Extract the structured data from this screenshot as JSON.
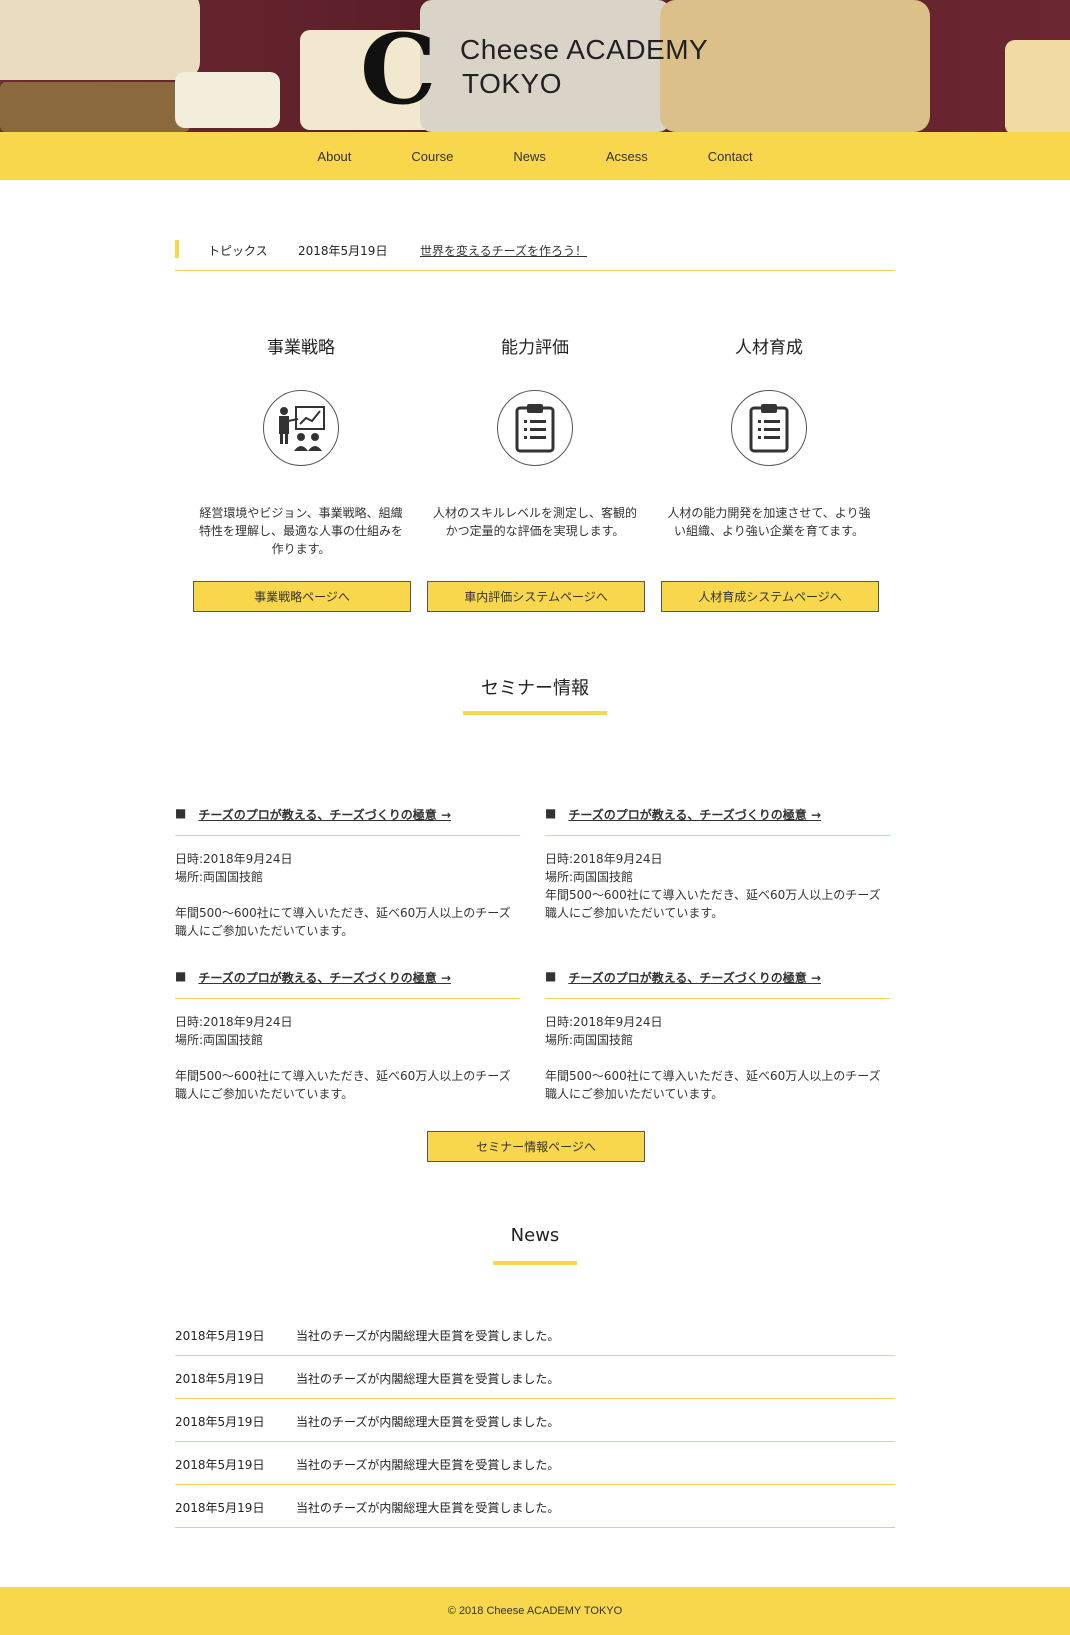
{
  "header": {
    "logo_letter": "C",
    "logo_line1": "Cheese ACADEMY",
    "logo_line2": "TOKYO"
  },
  "nav": [
    "About",
    "Course",
    "News",
    "Acsess",
    "Contact"
  ],
  "topics": {
    "label": "トピックス",
    "date": "2018年5月19日",
    "link": "世界を変えるチーズを作ろう！"
  },
  "features": [
    {
      "title": "事業戦略",
      "icon": "presentation-icon",
      "text": "経営環境やビジョン、事業戦略、組織特性を理解し、最適な人事の仕組みを作ります。",
      "button": "事業戦略ページへ"
    },
    {
      "title": "能力評価",
      "icon": "clipboard-icon",
      "text": "人材のスキルレベルを測定し、客観的かつ定量的な評価を実現します。",
      "button": "車内評価システムページへ"
    },
    {
      "title": "人材育成",
      "icon": "clipboard-icon",
      "text": "人材の能力開発を加速させて、より強い組織、より強い企業を育てます。",
      "button": "人材育成システムページへ"
    }
  ],
  "seminar": {
    "title": "セミナー情報",
    "items": [
      {
        "bullet": "■",
        "title": "チーズのプロが教える、チーズづくりの極意 →",
        "date": "日時:2018年9月24日",
        "place": "場所:両国国技館",
        "desc": "年間500〜600社にて導入いただき、延べ60万人以上のチーズ職人にご参加いただいています。"
      },
      {
        "bullet": "■",
        "title": "チーズのプロが教える、チーズづくりの極意 →",
        "date": "日時:2018年9月24日",
        "place": "場所:両国国技館",
        "desc": "年間500〜600社にて導入いただき、延べ60万人以上のチーズ職人にご参加いただいています。"
      },
      {
        "bullet": "■",
        "title": "チーズのプロが教える、チーズづくりの極意 →",
        "date": "日時:2018年9月24日",
        "place": "場所:両国国技館",
        "desc": "年間500〜600社にて導入いただき、延べ60万人以上のチーズ職人にご参加いただいています。"
      },
      {
        "bullet": "■",
        "title": "チーズのプロが教える、チーズづくりの極意 →",
        "date": "日時:2018年9月24日",
        "place": "場所:両国国技館",
        "desc": "年間500〜600社にて導入いただき、延べ60万人以上のチーズ職人にご参加いただいています。"
      }
    ],
    "button": "セミナー情報ページへ"
  },
  "news": {
    "title": "News",
    "items": [
      {
        "date": "2018年5月19日",
        "text": "当社のチーズが内閣総理大臣賞を受賞しました。"
      },
      {
        "date": "2018年5月19日",
        "text": "当社のチーズが内閣総理大臣賞を受賞しました。"
      },
      {
        "date": "2018年5月19日",
        "text": "当社のチーズが内閣総理大臣賞を受賞しました。"
      },
      {
        "date": "2018年5月19日",
        "text": "当社のチーズが内閣総理大臣賞を受賞しました。"
      },
      {
        "date": "2018年5月19日",
        "text": "当社のチーズが内閣総理大臣賞を受賞しました。"
      }
    ]
  },
  "footer": {
    "copyright": "© 2018 Cheese ACADEMY TOKYO"
  },
  "colors": {
    "accent": "#f9d74d",
    "hero_bg": "#5a1e28"
  }
}
